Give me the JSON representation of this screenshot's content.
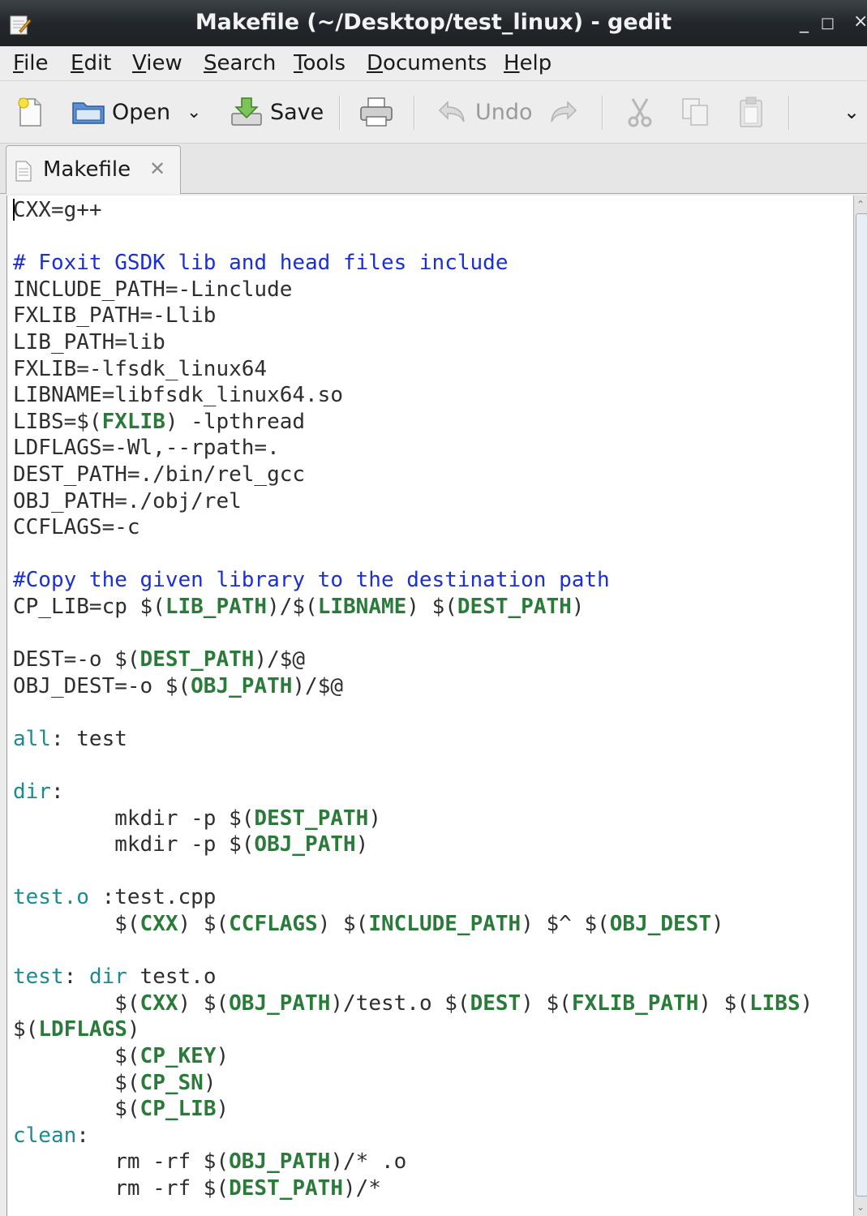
{
  "window": {
    "title": "Makefile (~/Desktop/test_linux) - gedit",
    "minimize": "_",
    "maximize": "□",
    "close": "×"
  },
  "menu": [
    {
      "first": "F",
      "rest": "ile"
    },
    {
      "first": "E",
      "rest": "dit"
    },
    {
      "first": "V",
      "rest": "iew"
    },
    {
      "first": "S",
      "rest": "earch"
    },
    {
      "first": "T",
      "rest": "ools"
    },
    {
      "first": "D",
      "rest": "ocuments"
    },
    {
      "first": "H",
      "rest": "elp"
    }
  ],
  "toolbar": {
    "open_label": "Open",
    "save_label": "Save",
    "undo_label": "Undo",
    "overflow": "⌄"
  },
  "tab": {
    "label": "Makefile",
    "close": "✕"
  },
  "code": [
    [
      [
        "p",
        "CXX=g++"
      ]
    ],
    [],
    [
      [
        "c",
        "# Foxit GSDK lib and head files include"
      ]
    ],
    [
      [
        "p",
        "INCLUDE_PATH=-Linclude"
      ]
    ],
    [
      [
        "p",
        "FXLIB_PATH=-Llib"
      ]
    ],
    [
      [
        "p",
        "LIB_PATH=lib"
      ]
    ],
    [
      [
        "p",
        "FXLIB=-lfsdk_linux64"
      ]
    ],
    [
      [
        "p",
        "LIBNAME=libfsdk_linux64.so"
      ]
    ],
    [
      [
        "p",
        "LIBS=$("
      ],
      [
        "v",
        "FXLIB"
      ],
      [
        "p",
        ") -lpthread"
      ]
    ],
    [
      [
        "p",
        "LDFLAGS=-Wl,--rpath=."
      ]
    ],
    [
      [
        "p",
        "DEST_PATH=./bin/rel_gcc"
      ]
    ],
    [
      [
        "p",
        "OBJ_PATH=./obj/rel"
      ]
    ],
    [
      [
        "p",
        "CCFLAGS=-c"
      ]
    ],
    [],
    [
      [
        "c",
        "#Copy the given library to the destination path"
      ]
    ],
    [
      [
        "p",
        "CP_LIB=cp $("
      ],
      [
        "v",
        "LIB_PATH"
      ],
      [
        "p",
        ")/$("
      ],
      [
        "v",
        "LIBNAME"
      ],
      [
        "p",
        ") $("
      ],
      [
        "v",
        "DEST_PATH"
      ],
      [
        "p",
        ")"
      ]
    ],
    [],
    [
      [
        "p",
        "DEST=-o $("
      ],
      [
        "v",
        "DEST_PATH"
      ],
      [
        "p",
        ")/$@"
      ]
    ],
    [
      [
        "p",
        "OBJ_DEST=-o $("
      ],
      [
        "v",
        "OBJ_PATH"
      ],
      [
        "p",
        ")/$@"
      ]
    ],
    [],
    [
      [
        "t",
        "all"
      ],
      [
        "p",
        ": test"
      ]
    ],
    [],
    [
      [
        "t",
        "dir"
      ],
      [
        "p",
        ":"
      ]
    ],
    [
      [
        "p",
        "        mkdir -p $("
      ],
      [
        "v",
        "DEST_PATH"
      ],
      [
        "p",
        ")"
      ]
    ],
    [
      [
        "p",
        "        mkdir -p $("
      ],
      [
        "v",
        "OBJ_PATH"
      ],
      [
        "p",
        ")"
      ]
    ],
    [],
    [
      [
        "t",
        "test.o"
      ],
      [
        "p",
        " :test.cpp"
      ]
    ],
    [
      [
        "p",
        "        $("
      ],
      [
        "v",
        "CXX"
      ],
      [
        "p",
        ") $("
      ],
      [
        "v",
        "CCFLAGS"
      ],
      [
        "p",
        ") $("
      ],
      [
        "v",
        "INCLUDE_PATH"
      ],
      [
        "p",
        ") $^ $("
      ],
      [
        "v",
        "OBJ_DEST"
      ],
      [
        "p",
        ")"
      ]
    ],
    [],
    [
      [
        "t",
        "test"
      ],
      [
        "p",
        ": "
      ],
      [
        "t",
        "dir"
      ],
      [
        "p",
        " test.o"
      ]
    ],
    [
      [
        "p",
        "        $("
      ],
      [
        "v",
        "CXX"
      ],
      [
        "p",
        ") $("
      ],
      [
        "v",
        "OBJ_PATH"
      ],
      [
        "p",
        ")/test.o $("
      ],
      [
        "v",
        "DEST"
      ],
      [
        "p",
        ") $("
      ],
      [
        "v",
        "FXLIB_PATH"
      ],
      [
        "p",
        ") $("
      ],
      [
        "v",
        "LIBS"
      ],
      [
        "p",
        ")"
      ]
    ],
    [
      [
        "p",
        "$("
      ],
      [
        "v",
        "LDFLAGS"
      ],
      [
        "p",
        ")"
      ]
    ],
    [
      [
        "p",
        "        $("
      ],
      [
        "v",
        "CP_KEY"
      ],
      [
        "p",
        ")"
      ]
    ],
    [
      [
        "p",
        "        $("
      ],
      [
        "v",
        "CP_SN"
      ],
      [
        "p",
        ")"
      ]
    ],
    [
      [
        "p",
        "        $("
      ],
      [
        "v",
        "CP_LIB"
      ],
      [
        "p",
        ")"
      ]
    ],
    [
      [
        "t",
        "clean"
      ],
      [
        "p",
        ":"
      ]
    ],
    [
      [
        "p",
        "        rm -rf $("
      ],
      [
        "v",
        "OBJ_PATH"
      ],
      [
        "p",
        ")/* .o"
      ]
    ],
    [
      [
        "p",
        "        rm -rf $("
      ],
      [
        "v",
        "DEST_PATH"
      ],
      [
        "p",
        ")/*"
      ]
    ]
  ]
}
